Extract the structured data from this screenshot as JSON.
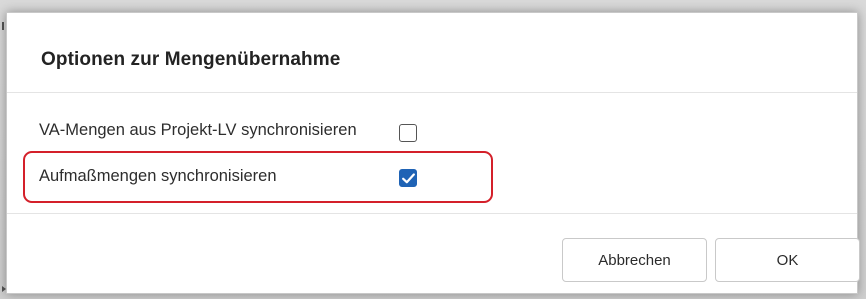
{
  "dialog": {
    "title": "Optionen zur Mengenübernahme",
    "options": [
      {
        "label": "VA-Mengen aus Projekt-LV synchronisieren",
        "checked": false
      },
      {
        "label": "Aufmaßmengen synchronisieren",
        "checked": true
      }
    ],
    "buttons": {
      "cancel": "Abbrechen",
      "ok": "OK"
    }
  },
  "colors": {
    "checkbox_checked": "#1f63b5",
    "highlight_border": "#d4202a"
  },
  "icons": {
    "checked": "checkmark-icon"
  }
}
